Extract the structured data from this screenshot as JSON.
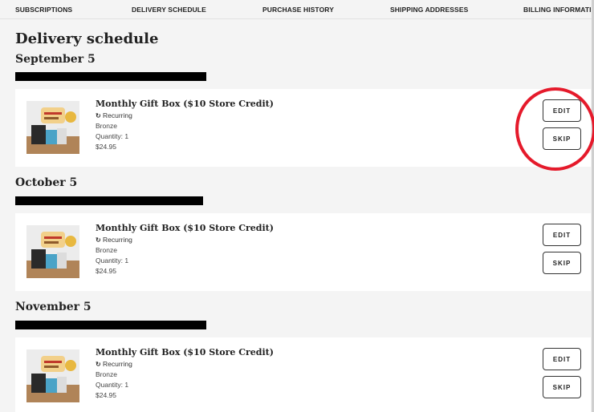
{
  "nav": {
    "items": [
      "SUBSCRIPTIONS",
      "DELIVERY SCHEDULE",
      "PURCHASE HISTORY",
      "SHIPPING ADDRESSES",
      "BILLING INFORMATION"
    ]
  },
  "page": {
    "title": "Delivery schedule"
  },
  "deliveries": [
    {
      "date": "September 5",
      "product_title": "Monthly Gift Box ($10 Store Credit)",
      "recurring_label": "Recurring",
      "tier": "Bronze",
      "quantity": "Quantity: 1",
      "price": "$24.95",
      "edit_label": "EDIT",
      "skip_label": "SKIP"
    },
    {
      "date": "October 5",
      "product_title": "Monthly Gift Box ($10 Store Credit)",
      "recurring_label": "Recurring",
      "tier": "Bronze",
      "quantity": "Quantity: 1",
      "price": "$24.95",
      "edit_label": "EDIT",
      "skip_label": "SKIP"
    },
    {
      "date": "November 5",
      "product_title": "Monthly Gift Box ($10 Store Credit)",
      "recurring_label": "Recurring",
      "tier": "Bronze",
      "quantity": "Quantity: 1",
      "price": "$24.95",
      "edit_label": "EDIT",
      "skip_label": "SKIP"
    }
  ],
  "icons": {
    "recurring": "refresh-icon"
  },
  "colors": {
    "annotation": "#e51a2b",
    "background": "#f4f4f4"
  }
}
